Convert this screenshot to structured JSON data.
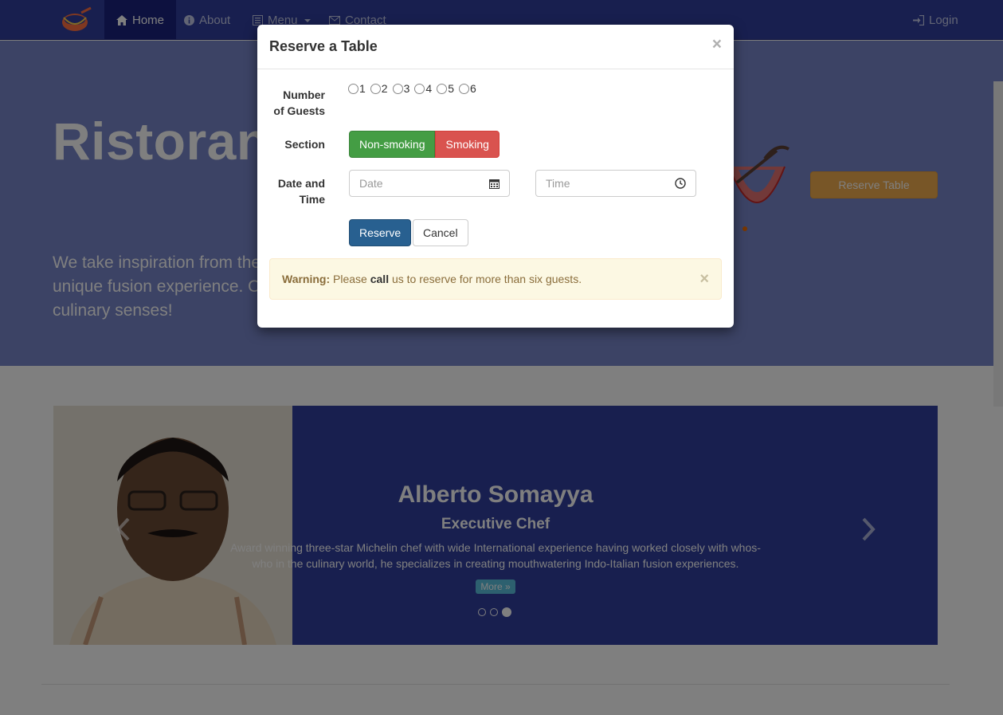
{
  "navbar": {
    "items": [
      {
        "label": "Home",
        "icon": "home-icon",
        "active": true
      },
      {
        "label": "About",
        "icon": "info-circle-icon"
      },
      {
        "label": "Menu",
        "icon": "list-alt-icon",
        "dropdown": true
      },
      {
        "label": "Contact",
        "icon": "envelope-icon"
      }
    ],
    "login_label": "Login",
    "login_icon": "log-in-icon"
  },
  "jumbotron": {
    "title": "Ristorante con Fusion",
    "text": "We take inspiration from the World's best cuisines, and create a unique fusion experience. Our lipsmacking creations will tickle your culinary senses!",
    "reserve_button": "Reserve Table"
  },
  "carousel": {
    "name": "Alberto Somayya",
    "title": "Executive Chef",
    "description": "Award winning three-star Michelin chef with wide International experience having worked closely with whos-who in the culinary world, he specializes in creating mouthwatering Indo-Italian fusion experiences.",
    "more_label": "More »",
    "slide_count": 3,
    "active_slide": 3
  },
  "modal": {
    "title": "Reserve a Table",
    "close": "×",
    "guests_label_line1": "Number",
    "guests_label_line2": "of Guests",
    "guest_options": [
      "1",
      "2",
      "3",
      "4",
      "5",
      "6"
    ],
    "section_label": "Section",
    "section_nonsmoking": "Non-smoking",
    "section_smoking": "Smoking",
    "datetime_label_line1": "Date and",
    "datetime_label_line2": "Time",
    "date_placeholder": "Date",
    "time_placeholder": "Time",
    "reserve_button": "Reserve",
    "cancel_button": "Cancel",
    "alert": {
      "strong": "Warning:",
      "text_before": " Please ",
      "bold": "call",
      "text_after": " us to reserve for more than six guests.",
      "close": "×"
    }
  },
  "colors": {
    "navbar": "#303F9F",
    "jumbotron": "#7986CB",
    "carousel": "#303F9F",
    "warning_bg": "#fcf8e3",
    "success": "#449d44",
    "danger": "#d9534f",
    "primary": "#286090",
    "orange": "#f0ad4e"
  }
}
